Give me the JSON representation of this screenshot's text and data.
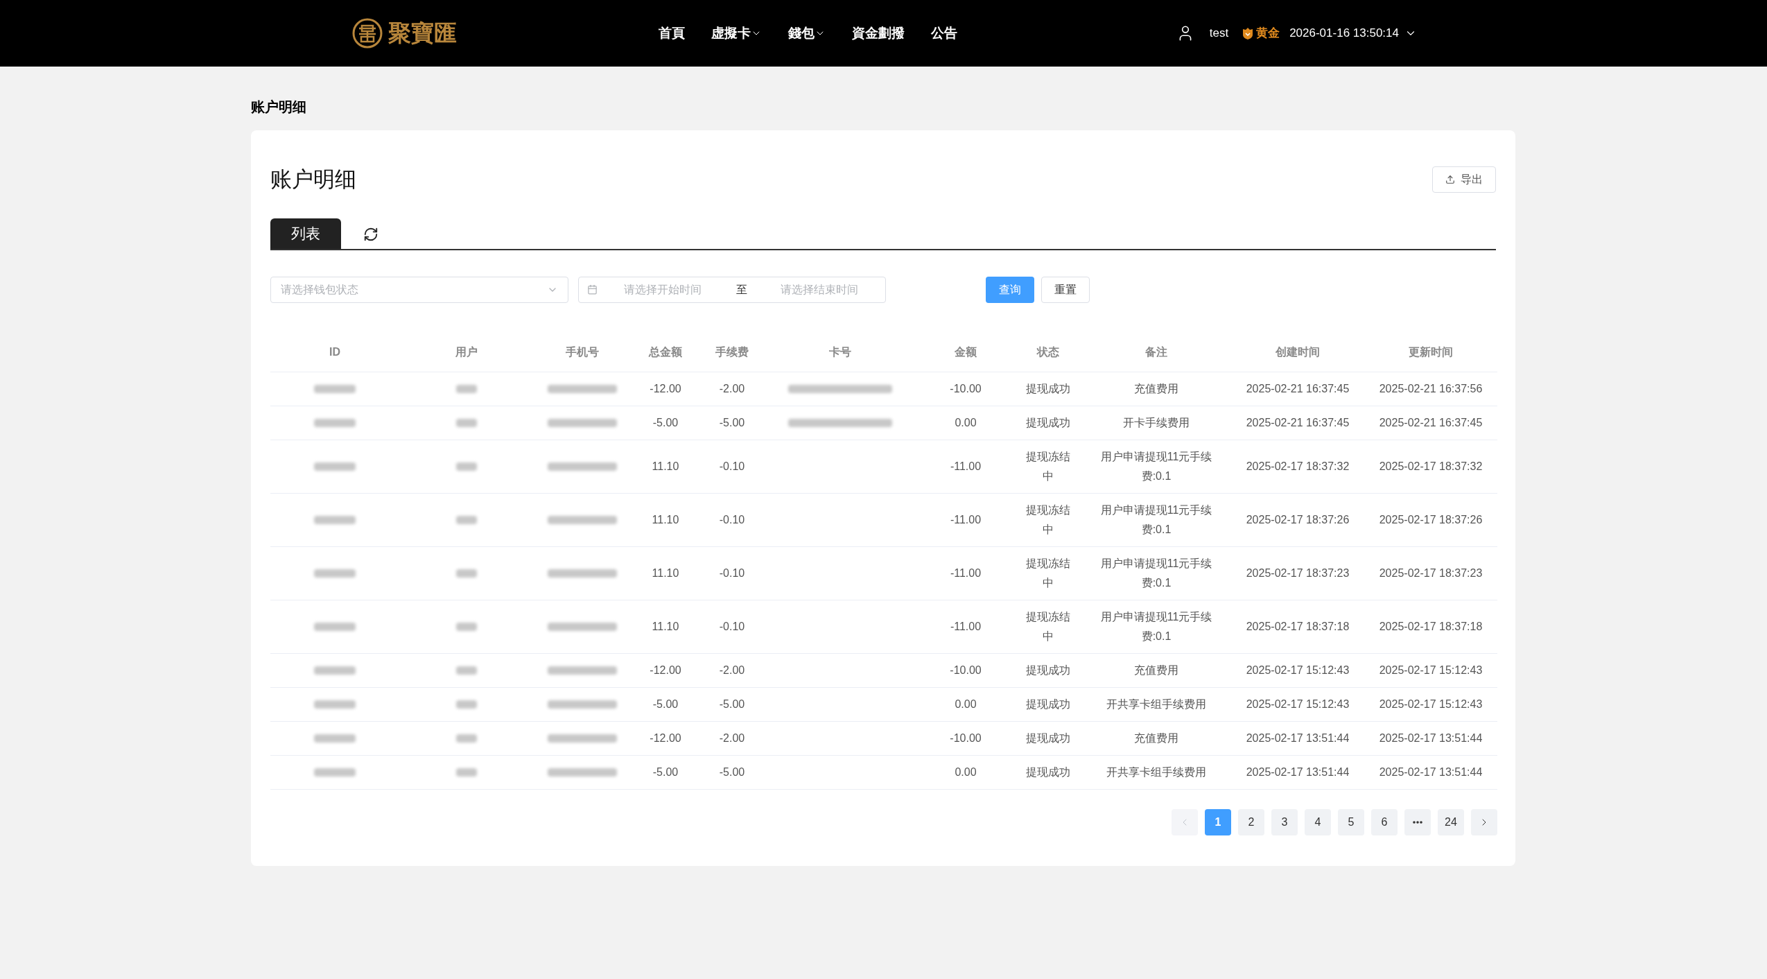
{
  "header": {
    "logo_text": "聚寶匯",
    "nav": [
      {
        "label": "首頁",
        "dropdown": false
      },
      {
        "label": "虚擬卡",
        "dropdown": true
      },
      {
        "label": "錢包",
        "dropdown": true
      },
      {
        "label": "資金劃撥",
        "dropdown": false
      },
      {
        "label": "公告",
        "dropdown": false
      }
    ],
    "user": {
      "name": "test",
      "level": "黄金",
      "datetime": "2026-01-16 13:50:14"
    }
  },
  "breadcrumb": "账户明细",
  "card": {
    "title": "账户明细",
    "export_label": "导出",
    "tabs": [
      {
        "label": "列表",
        "selected": true
      }
    ],
    "filters": {
      "status_placeholder": "请选择钱包状态",
      "start_placeholder": "请选择开始时间",
      "separator": "至",
      "end_placeholder": "请选择结束时间",
      "query_label": "查询",
      "reset_label": "重置"
    },
    "table": {
      "columns": [
        "ID",
        "用户",
        "手机号",
        "总金额",
        "手续费",
        "卡号",
        "金额",
        "状态",
        "备注",
        "创建时间",
        "更新时间"
      ],
      "rows": [
        {
          "card_redacted": true,
          "total": "-12.00",
          "fee": "-2.00",
          "amount": "-10.00",
          "status": "提现成功",
          "remark": "充值费用",
          "created": "2025-02-21 16:37:45",
          "updated": "2025-02-21 16:37:56"
        },
        {
          "card_redacted": true,
          "total": "-5.00",
          "fee": "-5.00",
          "amount": "0.00",
          "status": "提现成功",
          "remark": "开卡手续费用",
          "created": "2025-02-21 16:37:45",
          "updated": "2025-02-21 16:37:45"
        },
        {
          "card_redacted": false,
          "total": "11.10",
          "fee": "-0.10",
          "amount": "-11.00",
          "status": "提现冻结中",
          "remark": "用户申请提现11元手续费:0.1",
          "created": "2025-02-17 18:37:32",
          "updated": "2025-02-17 18:37:32"
        },
        {
          "card_redacted": false,
          "total": "11.10",
          "fee": "-0.10",
          "amount": "-11.00",
          "status": "提现冻结中",
          "remark": "用户申请提现11元手续费:0.1",
          "created": "2025-02-17 18:37:26",
          "updated": "2025-02-17 18:37:26"
        },
        {
          "card_redacted": false,
          "total": "11.10",
          "fee": "-0.10",
          "amount": "-11.00",
          "status": "提现冻结中",
          "remark": "用户申请提现11元手续费:0.1",
          "created": "2025-02-17 18:37:23",
          "updated": "2025-02-17 18:37:23"
        },
        {
          "card_redacted": false,
          "total": "11.10",
          "fee": "-0.10",
          "amount": "-11.00",
          "status": "提现冻结中",
          "remark": "用户申请提现11元手续费:0.1",
          "created": "2025-02-17 18:37:18",
          "updated": "2025-02-17 18:37:18"
        },
        {
          "card_redacted": false,
          "total": "-12.00",
          "fee": "-2.00",
          "amount": "-10.00",
          "status": "提现成功",
          "remark": "充值费用",
          "created": "2025-02-17 15:12:43",
          "updated": "2025-02-17 15:12:43"
        },
        {
          "card_redacted": false,
          "total": "-5.00",
          "fee": "-5.00",
          "amount": "0.00",
          "status": "提现成功",
          "remark": "开共享卡组手续费用",
          "created": "2025-02-17 15:12:43",
          "updated": "2025-02-17 15:12:43"
        },
        {
          "card_redacted": false,
          "total": "-12.00",
          "fee": "-2.00",
          "amount": "-10.00",
          "status": "提现成功",
          "remark": "充值费用",
          "created": "2025-02-17 13:51:44",
          "updated": "2025-02-17 13:51:44"
        },
        {
          "card_redacted": false,
          "total": "-5.00",
          "fee": "-5.00",
          "amount": "0.00",
          "status": "提现成功",
          "remark": "开共享卡组手续费用",
          "created": "2025-02-17 13:51:44",
          "updated": "2025-02-17 13:51:44"
        }
      ]
    },
    "pagination": {
      "prev_disabled": true,
      "next_disabled": false,
      "pages": [
        {
          "kind": "page",
          "label": "1",
          "selected": true
        },
        {
          "kind": "page",
          "label": "2",
          "selected": false
        },
        {
          "kind": "page",
          "label": "3",
          "selected": false
        },
        {
          "kind": "page",
          "label": "4",
          "selected": false
        },
        {
          "kind": "page",
          "label": "5",
          "selected": false
        },
        {
          "kind": "page",
          "label": "6",
          "selected": false
        },
        {
          "kind": "ellipsis"
        },
        {
          "kind": "page",
          "label": "24",
          "selected": false
        }
      ]
    }
  }
}
